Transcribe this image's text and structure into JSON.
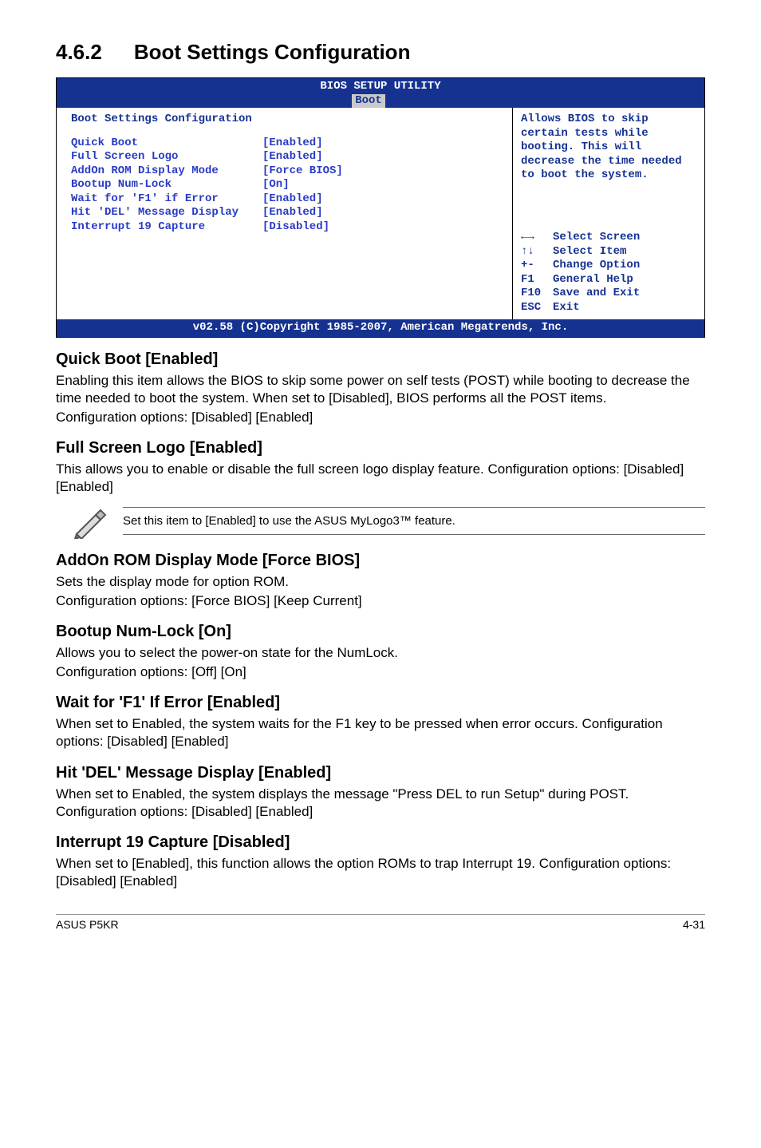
{
  "title": {
    "num": "4.6.2",
    "text": "Boot Settings Configuration"
  },
  "bios": {
    "header": "BIOS SETUP UTILITY",
    "tab": "Boot",
    "panel_title": "Boot Settings Configuration",
    "options": [
      {
        "label": "Quick Boot",
        "value": "[Enabled]"
      },
      {
        "label": "Full Screen Logo",
        "value": "[Enabled]"
      },
      {
        "label": "AddOn ROM Display Mode",
        "value": "[Force BIOS]"
      },
      {
        "label": "Bootup Num-Lock",
        "value": "[On]"
      },
      {
        "label": "Wait for 'F1' if Error",
        "value": "[Enabled]"
      },
      {
        "label": "Hit 'DEL' Message Display",
        "value": "[Enabled]"
      },
      {
        "label": "Interrupt 19 Capture",
        "value": "[Disabled]"
      }
    ],
    "help": "Allows BIOS to skip certain tests while booting. This will decrease the time needed to boot the system.",
    "nav": [
      {
        "key": "←→",
        "action": "Select Screen"
      },
      {
        "key": "↑↓",
        "action": "Select Item"
      },
      {
        "key": "+-",
        "action": "Change Option"
      },
      {
        "key": "F1",
        "action": "General Help"
      },
      {
        "key": "F10",
        "action": "Save and Exit"
      },
      {
        "key": "ESC",
        "action": "Exit"
      }
    ],
    "footer": "v02.58 (C)Copyright 1985-2007, American Megatrends, Inc."
  },
  "sections": {
    "quick_boot": {
      "heading": "Quick Boot [Enabled]",
      "p1": "Enabling this item allows the BIOS to skip some power on self tests (POST) while booting to decrease the time needed to boot the system. When set to [Disabled], BIOS performs all the POST items.",
      "p2": "Configuration options: [Disabled] [Enabled]"
    },
    "full_screen": {
      "heading": "Full Screen Logo [Enabled]",
      "p1": "This allows you to enable or disable the full screen logo display feature. Configuration options: [Disabled] [Enabled]"
    },
    "note": "Set this item to [Enabled] to use the ASUS MyLogo3™ feature.",
    "addon": {
      "heading": "AddOn ROM Display Mode [Force BIOS]",
      "p1": "Sets the display mode for option ROM.",
      "p2": "Configuration options: [Force BIOS] [Keep Current]"
    },
    "numlock": {
      "heading": "Bootup Num-Lock [On]",
      "p1": "Allows you to select the power-on state for the NumLock.",
      "p2": "Configuration options: [Off] [On]"
    },
    "wait_f1": {
      "heading": "Wait for 'F1' If Error [Enabled]",
      "p1": "When set to Enabled, the system waits for the F1 key to be pressed when error occurs. Configuration options: [Disabled] [Enabled]"
    },
    "hit_del": {
      "heading": "Hit 'DEL' Message Display [Enabled]",
      "p1": "When set to Enabled, the system displays the message \"Press DEL to run Setup\" during POST. Configuration options: [Disabled] [Enabled]"
    },
    "int19": {
      "heading": "Interrupt 19 Capture [Disabled]",
      "p1": "When set to [Enabled], this function allows the option ROMs to trap Interrupt 19. Configuration options: [Disabled] [Enabled]"
    }
  },
  "footer": {
    "left": "ASUS P5KR",
    "right": "4-31"
  }
}
